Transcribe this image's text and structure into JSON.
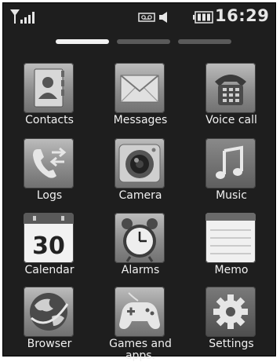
{
  "status": {
    "time": "16:29",
    "icons": [
      "signal-icon",
      "voicemail-icon",
      "speaker-icon",
      "battery-icon"
    ]
  },
  "pager": {
    "pages": 3,
    "active": 1
  },
  "apps": [
    {
      "label": "Contacts",
      "icon": "contacts-icon"
    },
    {
      "label": "Messages",
      "icon": "envelope-icon"
    },
    {
      "label": "Voice call",
      "icon": "telephone-icon"
    },
    {
      "label": "Logs",
      "icon": "call-log-icon"
    },
    {
      "label": "Camera",
      "icon": "camera-icon"
    },
    {
      "label": "Music",
      "icon": "music-note-icon"
    },
    {
      "label": "Calendar",
      "icon": "calendar-icon",
      "badge": "30"
    },
    {
      "label": "Alarms",
      "icon": "alarm-clock-icon"
    },
    {
      "label": "Memo",
      "icon": "memo-icon"
    },
    {
      "label": "Browser",
      "icon": "globe-icon"
    },
    {
      "label": "Games and\napps.",
      "icon": "gamepad-icon"
    },
    {
      "label": "Settings",
      "icon": "gear-icon"
    }
  ]
}
